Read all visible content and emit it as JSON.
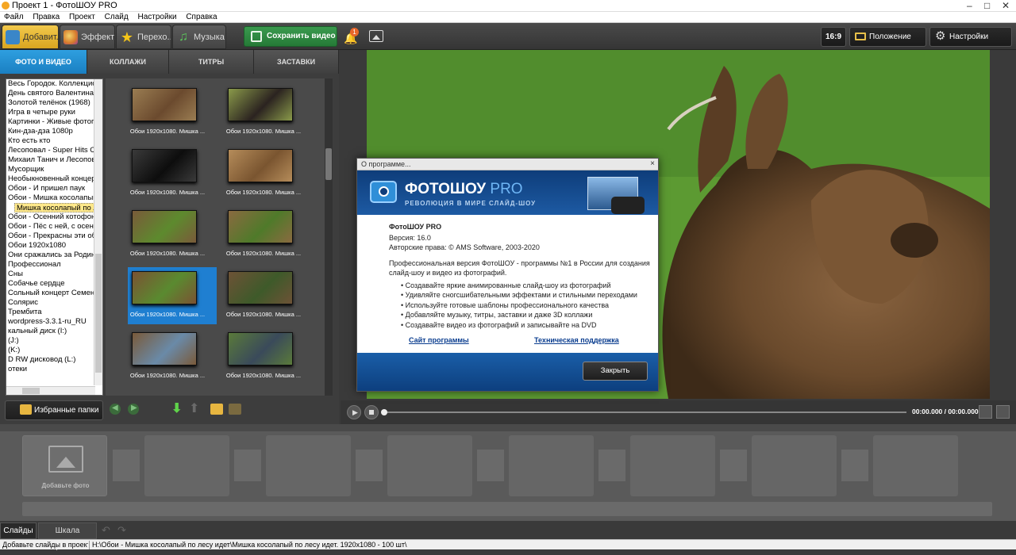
{
  "window": {
    "title": "Проект 1 - ФотоШОУ PRO"
  },
  "menu": [
    "Файл",
    "Правка",
    "Проект",
    "Слайд",
    "Настройки",
    "Справка"
  ],
  "toolbar": {
    "tabs": [
      {
        "label": "Добавит...",
        "icon": "photo-icon"
      },
      {
        "label": "Эффект...",
        "icon": "palette-icon"
      },
      {
        "label": "Перехо...",
        "icon": "star-icon"
      },
      {
        "label": "Музыка",
        "icon": "music-icon"
      }
    ],
    "save_label": "Сохранить видео",
    "notify_count": "1",
    "aspect_label": "16:9",
    "photo_position_label": "Положение фото",
    "project_settings_label": "Настройки проекта"
  },
  "subtabs": [
    "ФОТО И ВИДЕО",
    "КОЛЛАЖИ",
    "ТИТРЫ",
    "ЗАСТАВКИ"
  ],
  "folders": [
    "Весь Городок. Коллекционное",
    "День святого Валентина",
    "Золотой телёнок (1968)",
    "Игра в четыре руки",
    "Картинки - Живые фотографии",
    "Кин-дза-дза 1080p",
    "Кто есть кто",
    "Лесоповал - Super Hits Collection",
    "Михаил Танич и Лесоповал",
    "Мусорщик",
    "Необыкновенный концерт",
    "Обои - И пришел паук",
    "Обои - Мишка косолапый по лесу идет",
    "Мишка косолапый по лесу идет",
    "Обои - Осенний котофон",
    "Обои - Пёс с ней, с осенью",
    "Обои - Прекрасны эти облака",
    "Обои 1920x1080",
    "Они сражались за Родину",
    "Профессионал",
    "Сны",
    "Собачье сердце",
    "Сольный концерт Семена Слепакова",
    "Солярис",
    "Трембита",
    "wordpress-3.3.1-ru_RU",
    "кальный диск (I:)",
    "(J:)",
    "(K:)",
    "D RW дисковод (L:)",
    "отеки"
  ],
  "selected_folder_index": 13,
  "thumbnails": [
    {
      "caption": "Обои 1920x1080. Мишка ...",
      "c1": "#6b4a2e",
      "c2": "#9a7d52"
    },
    {
      "caption": "Обои 1920x1080. Мишка ...",
      "c1": "#2b2320",
      "c2": "#8a9a4a"
    },
    {
      "caption": "Обои 1920x1080. Мишка ...",
      "c1": "#0d0d0d",
      "c2": "#3a3a3a"
    },
    {
      "caption": "Обои 1920x1080. Мишка ...",
      "c1": "#7a5530",
      "c2": "#b58c5a"
    },
    {
      "caption": "Обои 1920x1080. Мишка ...",
      "c1": "#5d8a2e",
      "c2": "#7a5a3a"
    },
    {
      "caption": "Обои 1920x1080. Мишка ...",
      "c1": "#4f7a2a",
      "c2": "#8a6a40"
    },
    {
      "caption": "Обои 1920x1080. Мишка ...",
      "c1": "#5a8a30",
      "c2": "#7b5233"
    },
    {
      "caption": "Обои 1920x1080. Мишка ...",
      "c1": "#3e5a2a",
      "c2": "#6d5236"
    },
    {
      "caption": "Обои 1920x1080. Мишка ...",
      "c1": "#6a8aa8",
      "c2": "#7a5a3a"
    },
    {
      "caption": "Обои 1920x1080. Мишка ...",
      "c1": "#3a4a5a",
      "c2": "#5a7a3a"
    }
  ],
  "selected_thumbnail_index": 6,
  "favorites_label": "Избранные папки",
  "player": {
    "time": "00:00.000 / 00:00.000"
  },
  "about": {
    "title": "О программе...",
    "brand": "ФОТОШОУ",
    "brand_suffix": "PRO",
    "tagline": "РЕВОЛЮЦИЯ В МИРЕ СЛАЙД-ШОУ",
    "product": "ФотоШОУ PRO",
    "version": "Версия: 16.0",
    "copyright": "Авторские права: © AMS Software, 2003-2020",
    "description": "Профессиональная версия ФотоШОУ - программы №1 в России для создания слайд-шоу и видео из фотографий.",
    "bullets": [
      "Создавайте яркие анимированные слайд-шоу из фотографий",
      "Удивляйте сногсшибательными эффектами и стильными переходами",
      "Используйте готовые шаблоны профессионального качества",
      "Добавляйте музыку, титры, заставки и даже 3D коллажи",
      "Создавайте видео из фотографий и записывайте на DVD"
    ],
    "link_site": "Сайт программы",
    "link_support": "Техническая поддержка",
    "close_label": "Закрыть"
  },
  "timeline": {
    "add_photo_label": "Добавьте фото"
  },
  "bottom_tabs": [
    "Слайды",
    "Шкала времени"
  ],
  "status": {
    "left": "Добавьте слайды в проект...",
    "right": "H:\\Обои - Мишка косолапый по лесу идет\\Мишка косолапый по лесу идет. 1920x1080 - 100 шт\\"
  },
  "colors": {
    "accent": "#1f8ad4",
    "save_green": "#2f8c44",
    "tab_active": "#e6b43a"
  }
}
